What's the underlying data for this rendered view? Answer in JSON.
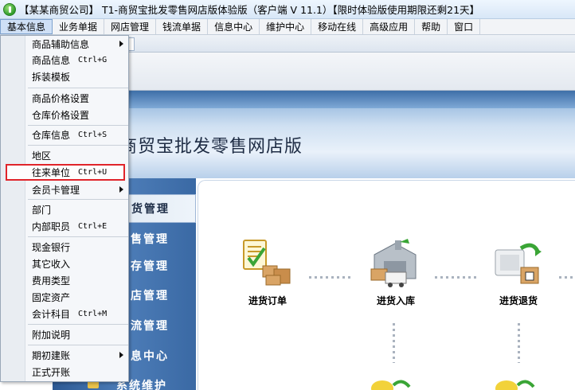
{
  "window": {
    "title": "【某某商贸公司】 T1-商贸宝批发零售网店版体验版（客户端 V 11.1）【限时体验版使用期限还剩21天】"
  },
  "menubar": [
    "基本信息",
    "业务单据",
    "网店管理",
    "钱流单据",
    "信息中心",
    "维护中心",
    "移动在线",
    "高级应用",
    "帮助",
    "窗口"
  ],
  "banner": {
    "title": "商贸宝批发零售网店版"
  },
  "leftnav": [
    "货管理",
    "售管理",
    "存管理",
    "店管理",
    "流管理",
    "息中心",
    "系统维护"
  ],
  "flow": [
    {
      "label": "进货订单",
      "icon": "purchase-order-icon"
    },
    {
      "label": "进货入库",
      "icon": "purchase-stock-in-icon"
    },
    {
      "label": "进货退货",
      "icon": "purchase-return-icon"
    }
  ],
  "dropdown": {
    "items": [
      {
        "label": "商品辅助信息",
        "shortcut": "",
        "submenu": true
      },
      {
        "label": "商品信息",
        "shortcut": "Ctrl+G",
        "submenu": false
      },
      {
        "label": "拆装模板",
        "shortcut": "",
        "submenu": false
      },
      {
        "label": "商品价格设置",
        "shortcut": "",
        "submenu": false
      },
      {
        "label": "仓库价格设置",
        "shortcut": "",
        "submenu": false
      },
      {
        "label": "仓库信息",
        "shortcut": "Ctrl+S",
        "submenu": false
      },
      {
        "label": "地区",
        "shortcut": "",
        "submenu": false
      },
      {
        "label": "往来单位",
        "shortcut": "Ctrl+U",
        "submenu": false,
        "highlighted": true
      },
      {
        "label": "会员卡管理",
        "shortcut": "",
        "submenu": true
      },
      {
        "label": "部门",
        "shortcut": "",
        "submenu": false
      },
      {
        "label": "内部职员",
        "shortcut": "Ctrl+E",
        "submenu": false
      },
      {
        "label": "现金银行",
        "shortcut": "",
        "submenu": false
      },
      {
        "label": "其它收入",
        "shortcut": "",
        "submenu": false
      },
      {
        "label": "费用类型",
        "shortcut": "",
        "submenu": false
      },
      {
        "label": "固定资产",
        "shortcut": "",
        "submenu": false
      },
      {
        "label": "会计科目",
        "shortcut": "Ctrl+M",
        "submenu": false
      },
      {
        "label": "附加说明",
        "shortcut": "",
        "submenu": false
      },
      {
        "label": "期初建账",
        "shortcut": "",
        "submenu": true
      },
      {
        "label": "正式开账",
        "shortcut": "",
        "submenu": false
      }
    ]
  },
  "colors": {
    "highlight_outline": "#e0242a",
    "nav_blue": "#3a69a4"
  }
}
